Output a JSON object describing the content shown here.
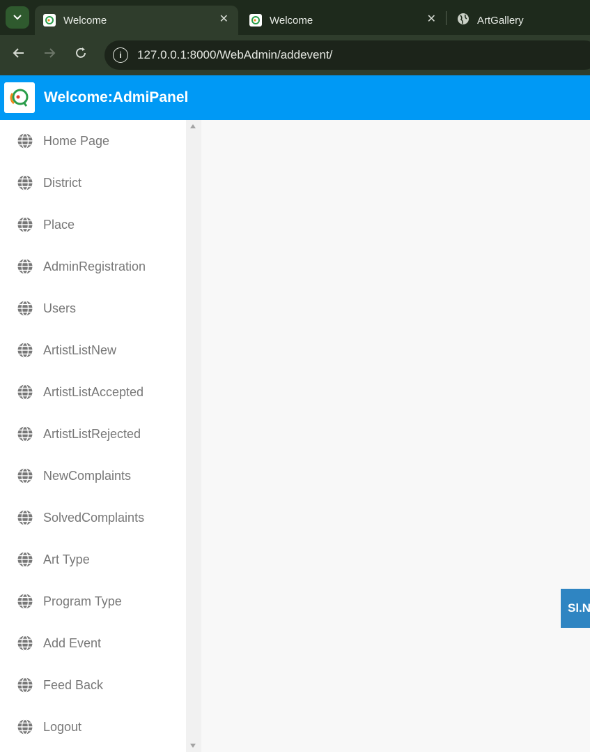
{
  "browser": {
    "tabs": [
      {
        "title": "Welcome",
        "active": true
      },
      {
        "title": "Welcome",
        "active": false
      },
      {
        "title": "ArtGallery",
        "active": false
      }
    ],
    "url": "127.0.0.1:8000/WebAdmin/addevent/"
  },
  "header": {
    "title": "Welcome:AdmiPanel",
    "bg_color": "#0099f5"
  },
  "sidebar": {
    "items": [
      {
        "label": "Home Page",
        "icon": "globe-icon"
      },
      {
        "label": "District",
        "icon": "globe-icon"
      },
      {
        "label": "Place",
        "icon": "globe-icon"
      },
      {
        "label": "AdminRegistration",
        "icon": "globe-icon"
      },
      {
        "label": "Users",
        "icon": "globe-icon"
      },
      {
        "label": "ArtistListNew",
        "icon": "globe-icon"
      },
      {
        "label": "ArtistListAccepted",
        "icon": "globe-icon"
      },
      {
        "label": "ArtistListRejected",
        "icon": "globe-icon"
      },
      {
        "label": "NewComplaints",
        "icon": "globe-icon"
      },
      {
        "label": "SolvedComplaints",
        "icon": "globe-icon"
      },
      {
        "label": "Art Type",
        "icon": "globe-icon"
      },
      {
        "label": "Program Type",
        "icon": "globe-icon"
      },
      {
        "label": "Add Event",
        "icon": "globe-icon"
      },
      {
        "label": "Feed Back",
        "icon": "globe-icon"
      },
      {
        "label": "Logout",
        "icon": "globe-icon"
      }
    ]
  },
  "main": {
    "table_header_visible": "Sl.N"
  }
}
